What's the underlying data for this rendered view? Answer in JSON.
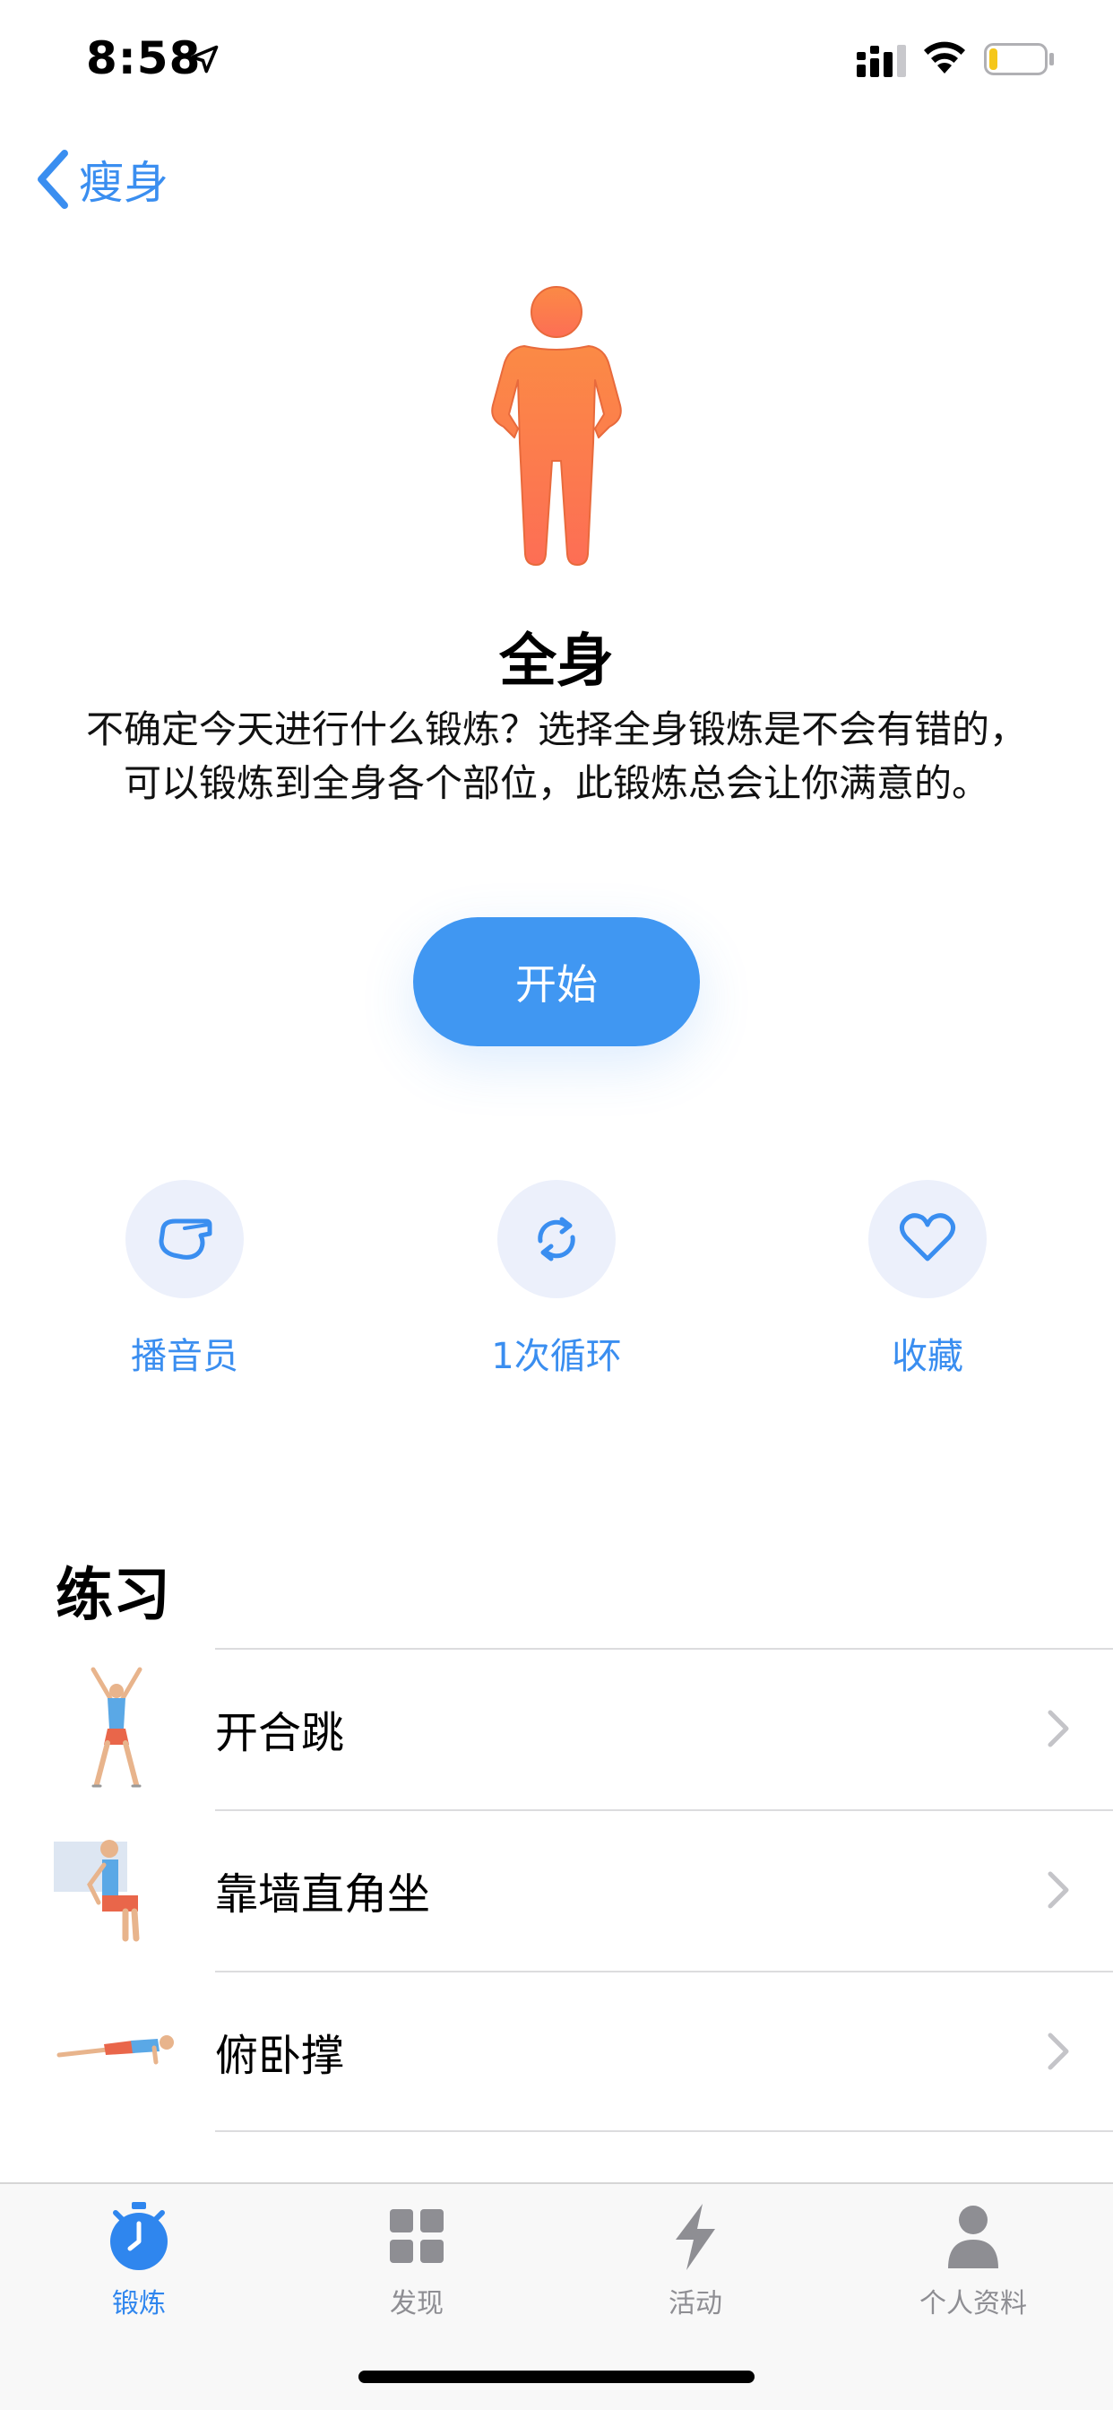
{
  "status_bar": {
    "time": "8:58",
    "battery_level": 0.15
  },
  "nav": {
    "back_label": "瘦身"
  },
  "workout": {
    "title": "全身",
    "description": "不确定今天进行什么锻炼？选择全身锻炼是不会有错的，可以锻炼到全身各个部位，此锻炼总会让你满意的。",
    "start_label": "开始"
  },
  "options": [
    {
      "label": "播音员",
      "icon": "whistle-icon"
    },
    {
      "label": "1次循环",
      "icon": "repeat-icon"
    },
    {
      "label": "收藏",
      "icon": "heart-icon"
    }
  ],
  "exercises": {
    "title": "练习",
    "items": [
      {
        "name": "开合跳",
        "icon": "jumping-jack-thumbnail"
      },
      {
        "name": "靠墙直角坐",
        "icon": "wall-sit-thumbnail"
      },
      {
        "name": "俯卧撑",
        "icon": "push-up-thumbnail"
      }
    ]
  },
  "tabs": [
    {
      "label": "锻炼",
      "icon": "stopwatch-icon",
      "active": true
    },
    {
      "label": "发现",
      "icon": "grid-icon",
      "active": false
    },
    {
      "label": "活动",
      "icon": "lightning-icon",
      "active": false
    },
    {
      "label": "个人资料",
      "icon": "person-icon",
      "active": false
    }
  ],
  "colors": {
    "accent": "#3a8ef0",
    "button": "#4097f2",
    "figure": "#fb7a45",
    "option_bg": "#ecf0fb",
    "tab_inactive": "#8e8e93"
  }
}
